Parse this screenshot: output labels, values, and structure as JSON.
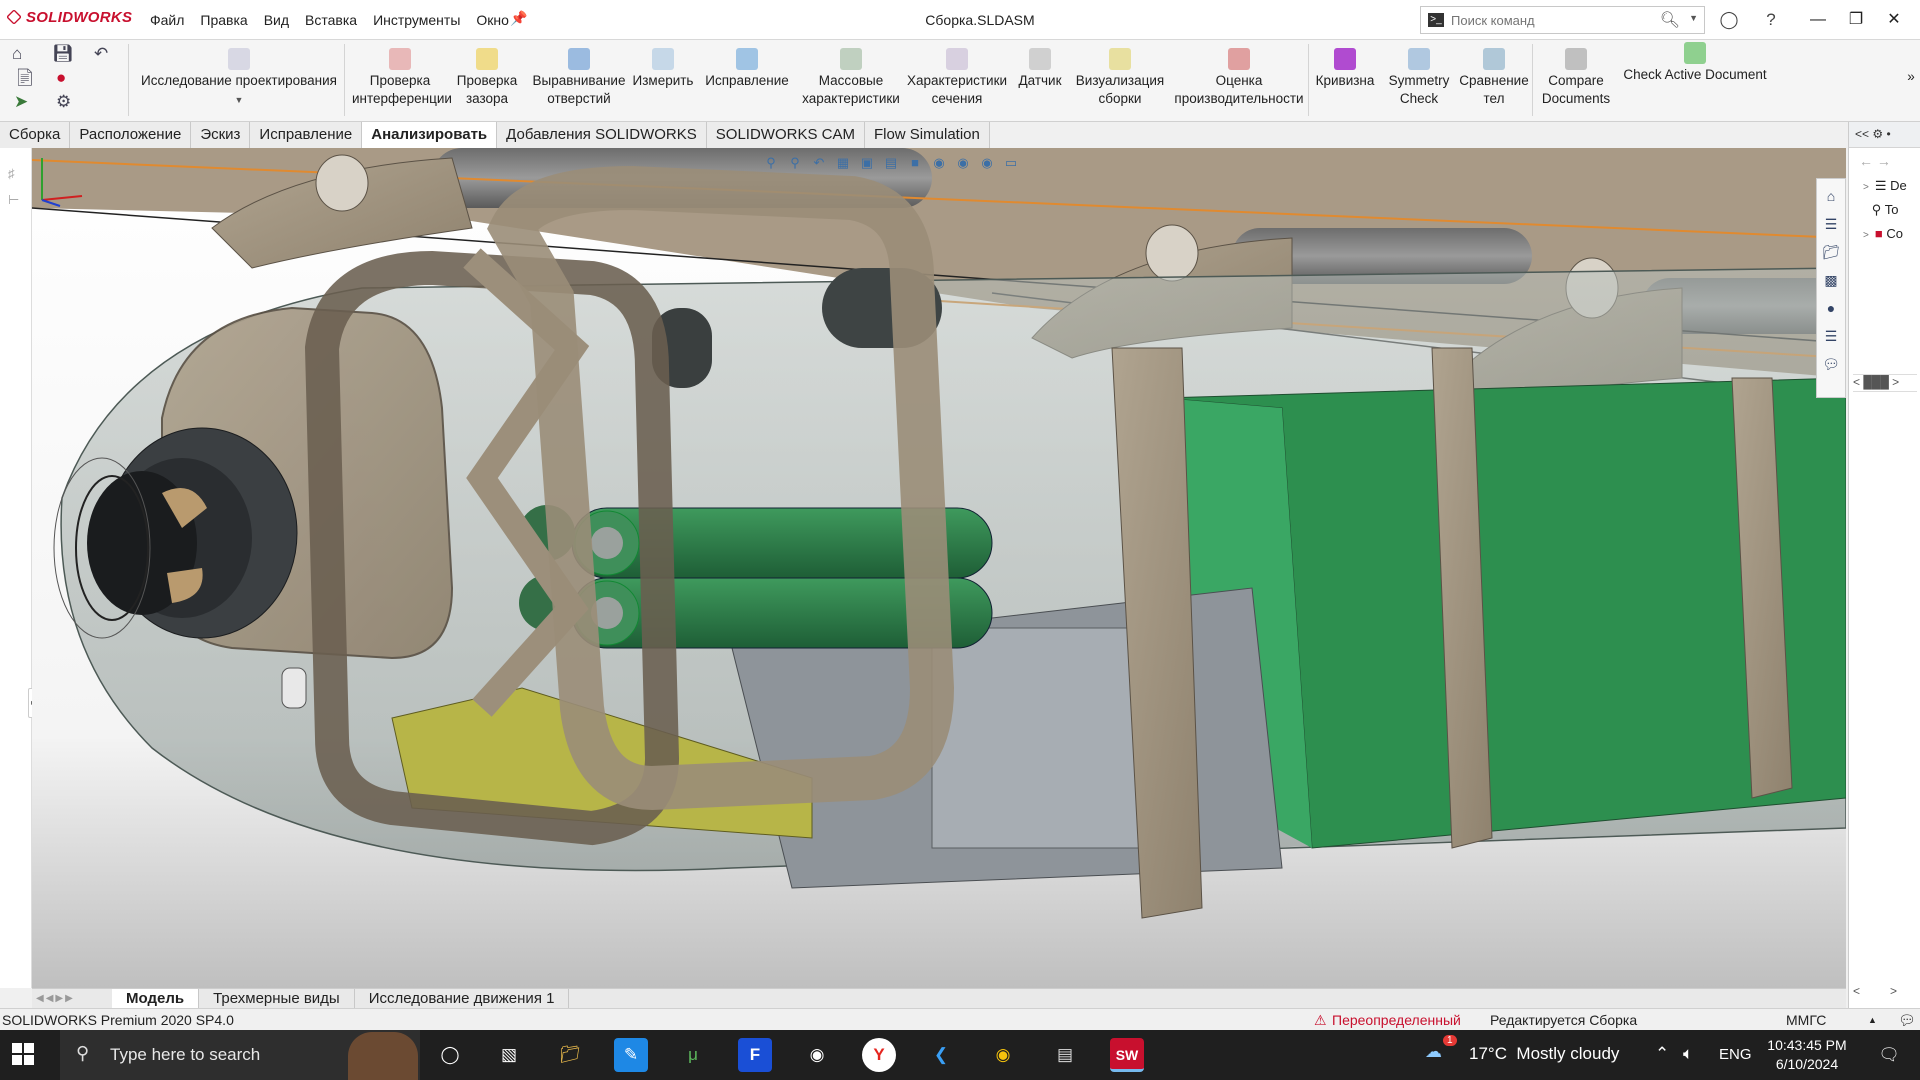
{
  "app": {
    "logo_text": "SOLIDWORKS",
    "document_title": "Сборка.SLDASM"
  },
  "menu": [
    "Файл",
    "Правка",
    "Вид",
    "Вставка",
    "Инструменты",
    "Окно"
  ],
  "search": {
    "placeholder": "Поиск команд"
  },
  "ribbon": {
    "design_study": "Исследование проектирования",
    "buttons": [
      {
        "l1": "Проверка",
        "l2": "интерференции",
        "icon": "interference-check-icon"
      },
      {
        "l1": "Проверка",
        "l2": "зазора",
        "icon": "clearance-check-icon"
      },
      {
        "l1": "Выравнивание",
        "l2": "отверстий",
        "icon": "hole-alignment-icon"
      },
      {
        "l1": "Измерить",
        "l2": "",
        "icon": "measure-icon"
      },
      {
        "l1": "Исправление",
        "l2": "",
        "icon": "repair-icon"
      },
      {
        "l1": "Массовые",
        "l2": "характеристики",
        "icon": "mass-properties-icon"
      },
      {
        "l1": "Характеристики",
        "l2": "сечения",
        "icon": "section-properties-icon"
      },
      {
        "l1": "Датчик",
        "l2": "",
        "icon": "sensor-icon"
      },
      {
        "l1": "Визуализация",
        "l2": "сборки",
        "icon": "assembly-visualization-icon"
      },
      {
        "l1": "Оценка",
        "l2": "производительности",
        "icon": "performance-evaluation-icon"
      },
      {
        "l1": "Кривизна",
        "l2": "",
        "icon": "curvature-icon"
      },
      {
        "l1": "Symmetry",
        "l2": "Check",
        "icon": "symmetry-check-icon"
      },
      {
        "l1": "Сравнение",
        "l2": "тел",
        "icon": "compare-bodies-icon"
      },
      {
        "l1": "Compare",
        "l2": "Documents",
        "icon": "compare-documents-icon"
      },
      {
        "l1": "Check Active Document",
        "l2": "",
        "icon": "check-active-document-icon"
      }
    ]
  },
  "tabs": [
    "Сборка",
    "Расположение",
    "Эскиз",
    "Исправление",
    "Анализировать",
    "Добавления SOLIDWORKS",
    "SOLIDWORKS CAM",
    "Flow Simulation"
  ],
  "active_tab": "Анализировать",
  "task_pane": {
    "items": [
      "De",
      "To",
      "Co"
    ]
  },
  "bottom_tabs": [
    "Модель",
    "Трехмерные виды",
    "Исследование движения 1"
  ],
  "status": {
    "product": "SOLIDWORKS Premium 2020 SP4.0",
    "overdefined": "Переопределенный",
    "editing": "Редактируется Сборка",
    "units": "ММГС"
  },
  "taskbar": {
    "search_text": "Type here to search",
    "weather": "17°C  Mostly cloudy",
    "language": "ENG",
    "time": "10:43:45 PM",
    "date": "6/10/2024",
    "weather_badge": "1"
  },
  "colors": {
    "brand": "#c8102e",
    "battery_green": "#2e8a52",
    "wood": "#a39682",
    "taskbar": "#1f1f1f"
  }
}
